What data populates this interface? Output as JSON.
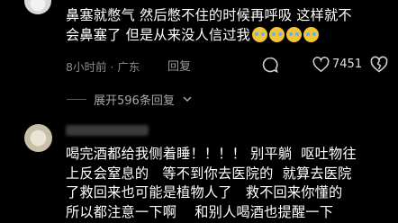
{
  "comment_1": {
    "lines": [
      "鼻塞就憋气 然后憋不住的时候再呼吸 这样就不",
      "会鼻塞了 但是从来没人信过我"
    ],
    "time_location": "8小时前 · 广东",
    "reply_label": "回复",
    "like_count": "7451",
    "expand_replies": "展开596条回复"
  },
  "comment_2": {
    "lines": [
      "喝完酒都给我侧着睡！！！！ 别平躺  呕吐物往",
      "上反会窒息的   等不到你去医院的  就算去医院",
      "了救回来也可能是植物人了   救不回来你懂的",
      "所以都注意一下啊    和别人喝酒也提醒一下"
    ]
  },
  "icons": {
    "emoji": "crying-face-emoji",
    "chat": "chat-bubble-icon",
    "heart": "heart-icon",
    "dislike": "broken-heart-icon",
    "chevron": "chevron-down-icon"
  }
}
